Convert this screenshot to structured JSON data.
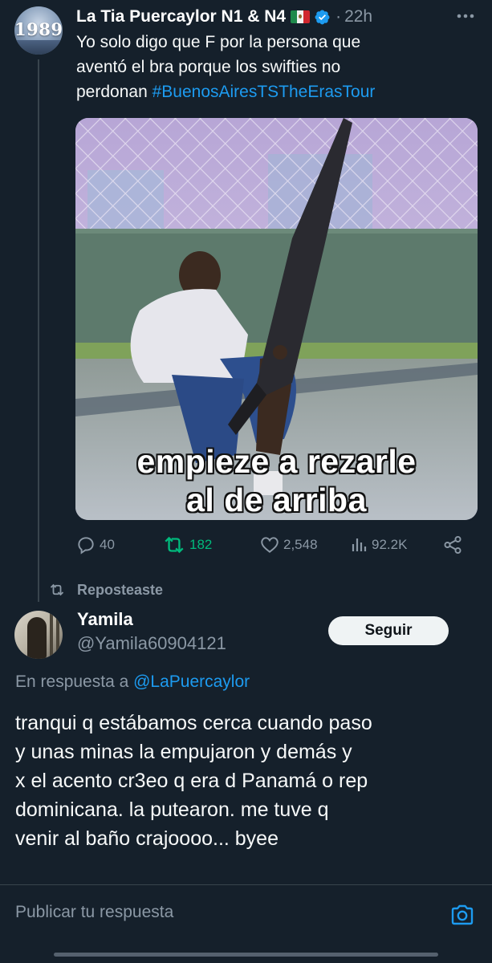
{
  "colors": {
    "background": "#15202b",
    "accent": "#1d9bf0",
    "muted": "#8b98a5",
    "repost_green": "#00ba7c"
  },
  "parent_tweet": {
    "avatar_text": "1989",
    "author_name": "La Tia Puercaylor N1 & N4",
    "flag_icon": "mexico-flag",
    "verified_icon": "verified-badge-icon",
    "separator": "·",
    "time": "22h",
    "text_lines": [
      "Yo solo digo que F por la persona que",
      "aventó el bra porque los swifties no",
      "perdonan "
    ],
    "hashtag": "#BuenosAiresTSTheErasTour",
    "image_caption_line1": "empieze a rezarle",
    "image_caption_line2": "al de arriba",
    "actions": {
      "replies": "40",
      "reposts": "182",
      "likes": "2,548",
      "views": "92.2K"
    }
  },
  "reposted_label": "Reposteaste",
  "reply_tweet": {
    "author_name": "Yamila",
    "author_handle": "@Yamila60904121",
    "follow_label": "Seguir",
    "reply_to_prefix": "En respuesta a ",
    "reply_to_mention": "@LaPuercaylor",
    "text_lines": [
      "tranqui q estábamos cerca cuando paso",
      "y unas minas la empujaron y demás y",
      "x el acento cr3eo q era d Panamá o rep",
      "dominicana. la putearon.  me tuve q",
      "venir al baño crajoooo... byee"
    ]
  },
  "composer": {
    "placeholder": "Publicar tu respuesta",
    "camera_icon": "camera-icon"
  }
}
